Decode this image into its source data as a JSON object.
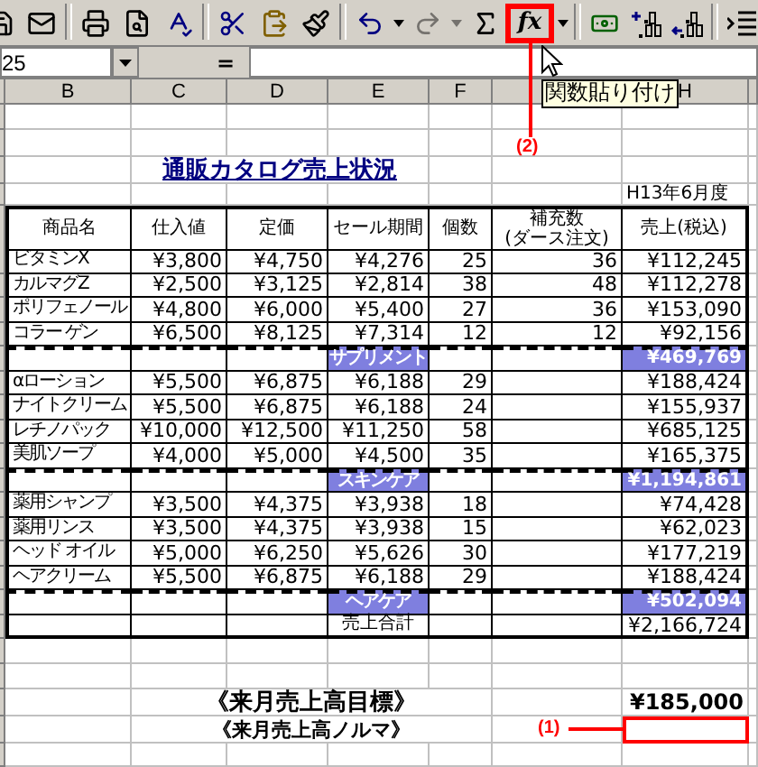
{
  "toolbar": {
    "buttons": [
      {
        "kind": "save",
        "disabled": false
      },
      {
        "kind": "mail",
        "disabled": false
      },
      {
        "kind": "separator"
      },
      {
        "kind": "print",
        "disabled": false
      },
      {
        "kind": "preview",
        "disabled": false
      },
      {
        "kind": "spell",
        "disabled": false
      },
      {
        "kind": "separator"
      },
      {
        "kind": "cut",
        "disabled": false
      },
      {
        "kind": "paste",
        "disabled": false
      },
      {
        "kind": "brush",
        "disabled": false
      },
      {
        "kind": "separator"
      },
      {
        "kind": "undo",
        "disabled": false
      },
      {
        "kind": "dropdown",
        "disabled": false
      },
      {
        "kind": "redo",
        "disabled": true
      },
      {
        "kind": "dropdown",
        "disabled": true
      },
      {
        "kind": "sum",
        "disabled": false
      },
      {
        "kind": "function",
        "label": "fx",
        "highlighted": true,
        "disabled": false
      },
      {
        "kind": "dropdown",
        "disabled": false
      },
      {
        "kind": "separator"
      },
      {
        "kind": "currency",
        "disabled": false
      },
      {
        "kind": "inc_decimal",
        "disabled": false
      },
      {
        "kind": "dec_decimal",
        "disabled": false
      },
      {
        "kind": "separator"
      },
      {
        "kind": "indent",
        "disabled": false
      }
    ]
  },
  "formula_bar": {
    "name_box": "25",
    "equals": "="
  },
  "column_headers": [
    {
      "kind": "letter",
      "label": "B"
    },
    {
      "kind": "letter",
      "label": "C"
    },
    {
      "kind": "letter",
      "label": "D"
    },
    {
      "kind": "letter",
      "label": "E"
    },
    {
      "kind": "letter",
      "label": "F"
    },
    {
      "kind": "covered"
    },
    {
      "kind": "letter",
      "label": "H"
    }
  ],
  "title": "通販カタログ売上状況",
  "period": "H13年6月度",
  "table": {
    "columns": [
      "商品名",
      "仕入値",
      "定価",
      "セール期間",
      "個数",
      "補充数",
      "(ダース注文)",
      "売上(税込)"
    ],
    "rows": [
      {
        "kind": "item",
        "cells": [
          "ビタミンX",
          "¥3,800",
          "¥4,750",
          "¥4,276",
          "25",
          "36",
          "¥112,245"
        ]
      },
      {
        "kind": "item",
        "cells": [
          "カルマグZ",
          "¥2,500",
          "¥3,125",
          "¥2,814",
          "38",
          "48",
          "¥112,278"
        ]
      },
      {
        "kind": "item",
        "cells": [
          "ポリフェノール",
          "¥4,800",
          "¥6,000",
          "¥5,400",
          "27",
          "36",
          "¥153,090"
        ]
      },
      {
        "kind": "item",
        "cells": [
          "コラー ゲン",
          "¥6,500",
          "¥8,125",
          "¥7,314",
          "12",
          "12",
          "¥92,156"
        ]
      },
      {
        "kind": "subtotal",
        "category": "サプリメント",
        "amount": "¥469,769"
      },
      {
        "kind": "item",
        "cells": [
          "αローション",
          "¥5,500",
          "¥6,875",
          "¥6,188",
          "29",
          null,
          "¥188,424"
        ]
      },
      {
        "kind": "item",
        "cells": [
          "ナイトクリーム",
          "¥5,500",
          "¥6,875",
          "¥6,188",
          "24",
          null,
          "¥155,937"
        ]
      },
      {
        "kind": "item",
        "cells": [
          "レチノパック",
          "¥10,000",
          "¥12,500",
          "¥11,250",
          "58",
          null,
          "¥685,125"
        ]
      },
      {
        "kind": "item",
        "cells": [
          "美肌ソープ",
          "¥4,000",
          "¥5,000",
          "¥4,500",
          "35",
          null,
          "¥165,375"
        ]
      },
      {
        "kind": "subtotal",
        "category": "スキンケア",
        "amount": "¥1,194,861"
      },
      {
        "kind": "item",
        "cells": [
          "薬用シャンプ",
          "¥3,500",
          "¥4,375",
          "¥3,938",
          "18",
          null,
          "¥74,428"
        ]
      },
      {
        "kind": "item",
        "cells": [
          "薬用リンス",
          "¥3,500",
          "¥4,375",
          "¥3,938",
          "15",
          null,
          "¥62,023"
        ]
      },
      {
        "kind": "item",
        "cells": [
          "ヘッド オイル",
          "¥5,000",
          "¥6,250",
          "¥5,626",
          "30",
          null,
          "¥177,219"
        ]
      },
      {
        "kind": "item",
        "cells": [
          "ヘアクリーム",
          "¥5,500",
          "¥6,875",
          "¥6,188",
          "29",
          null,
          "¥188,424"
        ]
      },
      {
        "kind": "subtotal",
        "category": "ヘアケア",
        "amount": "¥502,094"
      },
      {
        "kind": "total",
        "label": "売上合計",
        "amount": "¥2,166,724"
      }
    ]
  },
  "targets": [
    {
      "label": "《来月売上高目標》",
      "value": "¥185,000",
      "selected": false
    },
    {
      "label": "《来月売上高ノルマ》",
      "selected": true
    }
  ],
  "callouts": [
    "(1)",
    "(2)"
  ],
  "tooltip": "関数貼り付け"
}
